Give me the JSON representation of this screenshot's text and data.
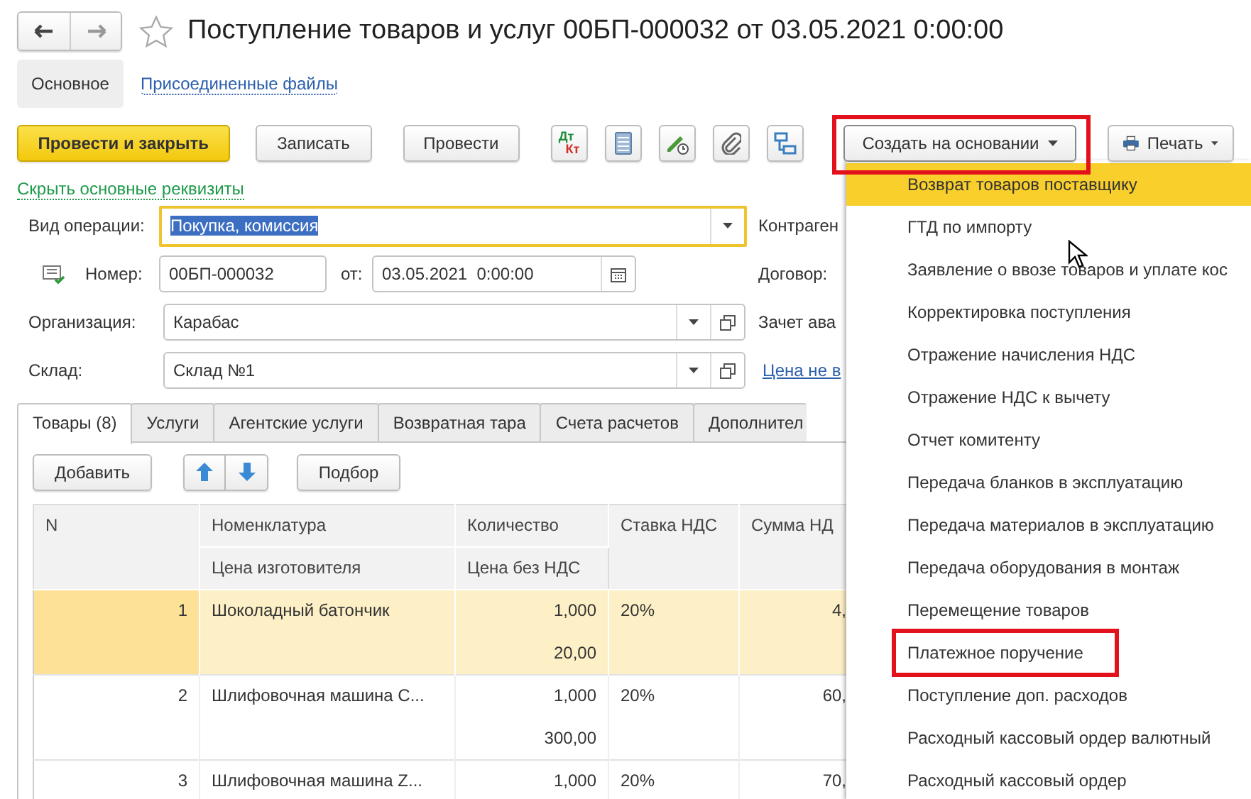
{
  "window": {
    "title": "Поступление товаров и услуг 00БП-000032 от 03.05.2021 0:00:00",
    "favorite": false
  },
  "sections": [
    {
      "label": "Основное",
      "selected": true
    },
    {
      "label": "Присоединенные файлы",
      "selected": false
    }
  ],
  "toolbar": {
    "buttons": [
      {
        "label": "Провести и закрыть",
        "kind": "primary"
      },
      {
        "label": "Записать",
        "kind": "plain"
      },
      {
        "label": "Провести",
        "kind": "plain"
      }
    ],
    "icons": [
      {
        "kind": "debit-credit",
        "top": "Дт",
        "bottom": "Кт"
      },
      {
        "kind": "list"
      },
      {
        "kind": "edit"
      },
      {
        "kind": "attach"
      },
      {
        "kind": "structure"
      }
    ],
    "create_button": {
      "label": "Создать на основании",
      "highlighted": true
    },
    "print_button": {
      "label": "Печать"
    }
  },
  "hide_link": "Скрыть основные реквизиты",
  "fields": {
    "operation": {
      "label": "Вид операции:",
      "value": "Покупка, комиссия",
      "focused": true
    },
    "number": {
      "label": "Номер:",
      "value": "00БП-000032"
    },
    "date": {
      "label": "от:",
      "value": "03.05.2021  0:00:00"
    },
    "organization": {
      "label": "Организация:",
      "value": "Карабас"
    },
    "warehouse": {
      "label": "Склад:",
      "value": "Склад №1"
    }
  },
  "right_labels": [
    {
      "text": "Контраген",
      "kind": "label"
    },
    {
      "text": "Договор:",
      "kind": "label"
    },
    {
      "text": "Зачет ава",
      "kind": "label"
    },
    {
      "text": "Цена не в",
      "kind": "link"
    }
  ],
  "tabs": [
    {
      "label": "Товары (8)",
      "selected": true
    },
    {
      "label": "Услуги",
      "selected": false
    },
    {
      "label": "Агентские услуги",
      "selected": false
    },
    {
      "label": "Возвратная тара",
      "selected": false
    },
    {
      "label": "Счета расчетов",
      "selected": false
    },
    {
      "label": "Дополнител",
      "selected": false
    }
  ],
  "table_buttons": {
    "add": "Добавить",
    "pick": "Подбор"
  },
  "table": {
    "columns": [
      {
        "label": "N"
      },
      {
        "label": "Номенклатура",
        "sub": "Цена изготовителя"
      },
      {
        "label": "Количество",
        "sub": "Цена без НДС"
      },
      {
        "label": "Ставка НДС"
      },
      {
        "label": "Сумма НД"
      }
    ],
    "rows": [
      {
        "n": "1",
        "name": "Шоколадный батончик",
        "quantity": "1,000",
        "price": "20,00",
        "vat_rate": "20%",
        "vat_sum": "4,",
        "selected": true
      },
      {
        "n": "2",
        "name": "Шлифовочная машина С...",
        "quantity": "1,000",
        "price": "300,00",
        "vat_rate": "20%",
        "vat_sum": "60,",
        "selected": false
      },
      {
        "n": "3",
        "name": "Шлифовочная машина Z...",
        "quantity": "1,000",
        "vat_rate": "20%",
        "vat_sum": "70,",
        "selected": false
      }
    ]
  },
  "menu": {
    "items": [
      {
        "label": "Возврат товаров поставщику",
        "selected": true,
        "highlighted": false
      },
      {
        "label": "ГТД по импорту",
        "selected": false,
        "highlighted": false
      },
      {
        "label": "Заявление о ввозе товаров и уплате кос",
        "selected": false,
        "highlighted": false
      },
      {
        "label": "Корректировка поступления",
        "selected": false,
        "highlighted": false
      },
      {
        "label": "Отражение начисления НДС",
        "selected": false,
        "highlighted": false
      },
      {
        "label": "Отражение НДС к вычету",
        "selected": false,
        "highlighted": false
      },
      {
        "label": "Отчет комитенту",
        "selected": false,
        "highlighted": false
      },
      {
        "label": "Передача бланков в эксплуатацию",
        "selected": false,
        "highlighted": false
      },
      {
        "label": "Передача материалов в эксплуатацию",
        "selected": false,
        "highlighted": false
      },
      {
        "label": "Передача оборудования в монтаж",
        "selected": false,
        "highlighted": false
      },
      {
        "label": "Перемещение товаров",
        "selected": false,
        "highlighted": false
      },
      {
        "label": "Платежное поручение",
        "selected": false,
        "highlighted": true
      },
      {
        "label": "Поступление доп. расходов",
        "selected": false,
        "highlighted": false
      },
      {
        "label": "Расходный кассовый ордер валютный",
        "selected": false,
        "highlighted": false
      },
      {
        "label": "Расходный кассовый ордер",
        "selected": false,
        "highlighted": false
      }
    ]
  }
}
